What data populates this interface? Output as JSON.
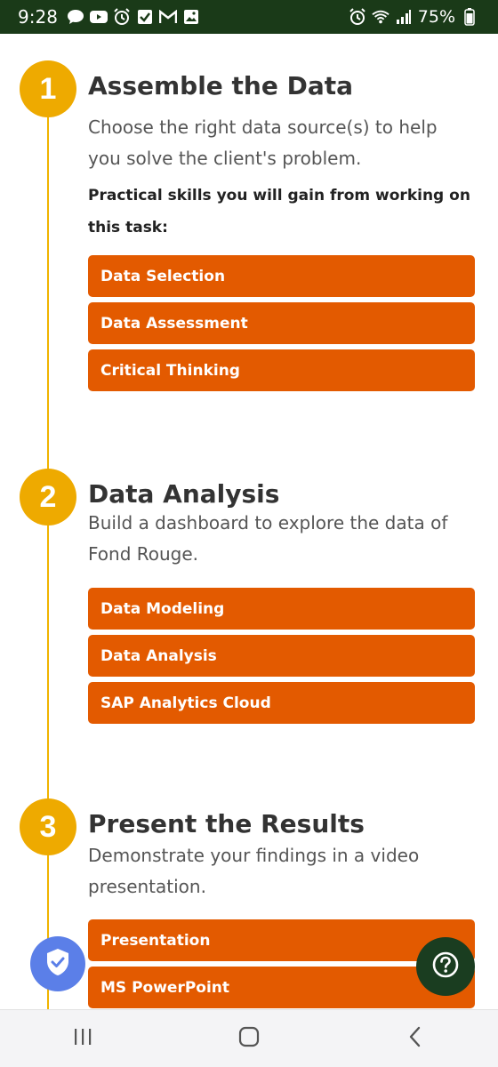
{
  "status_bar": {
    "time": "9:28",
    "battery": "75%",
    "left_icons": [
      "chat-icon",
      "youtube-icon",
      "alarm-icon",
      "check-icon",
      "gmail-icon",
      "gallery-icon"
    ],
    "right_icons": [
      "alarm-icon",
      "wifi-icon",
      "signal-icon",
      "battery-icon"
    ]
  },
  "steps": [
    {
      "number": "1",
      "title": "Assemble the Data",
      "description": "Choose the right data source(s) to help you solve the client's problem.",
      "skills_label": "Practical skills you will gain from working on this task:",
      "skills": [
        "Data Selection",
        "Data Assessment",
        "Critical Thinking"
      ]
    },
    {
      "number": "2",
      "title": "Data Analysis",
      "description": "Build a dashboard to explore the data of Fond Rouge.",
      "skills": [
        "Data Modeling",
        "Data Analysis",
        "SAP Analytics Cloud"
      ]
    },
    {
      "number": "3",
      "title": "Present the Results",
      "description": "Demonstrate your findings in a video presentation.",
      "skills": [
        "Presentation",
        "MS PowerPoint"
      ]
    }
  ],
  "colors": {
    "status_bar": "#1a3a18",
    "step_circle": "#eeaa00",
    "timeline": "#f0b400",
    "skill_button": "#e35a00",
    "shield_button": "#5b7fe8",
    "help_button": "#1a3d20"
  },
  "floating": {
    "shield_icon": "shield-check-icon",
    "help_icon": "question-circle-icon"
  },
  "nav_bar": {
    "icons": [
      "recent-apps-icon",
      "home-icon",
      "back-icon"
    ]
  }
}
